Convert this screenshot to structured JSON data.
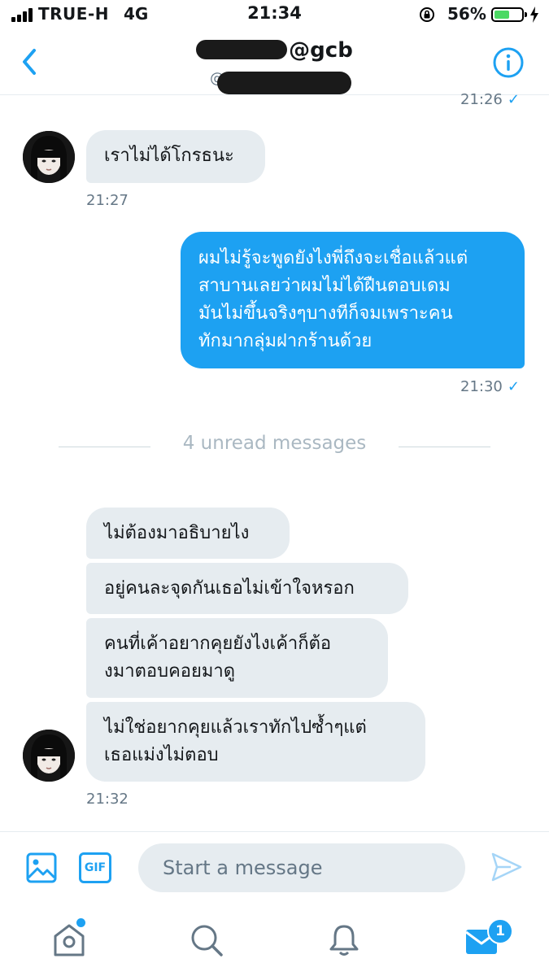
{
  "status_bar": {
    "carrier": "TRUE-H",
    "network": "4G",
    "time": "21:34",
    "battery_percent": "56%",
    "battery_level": 0.56,
    "icons": [
      "signal-icon",
      "orientation-lock-icon",
      "battery-icon",
      "charging-bolt-icon"
    ]
  },
  "header": {
    "title_handle": "@gcb",
    "back_icon": "chevron-left-icon",
    "info_icon": "info-icon",
    "accent_color": "#1da1f2"
  },
  "messages": {
    "top_timestamp": "21:26",
    "received_1": {
      "text": "เราไม่ได้โกรธนะ",
      "time": "21:27"
    },
    "sent_1": {
      "text": "ผมไม่รู้จะพูดยังไงพี่ถึงจะเชื่อแล้วแต่\nสาบานเลยว่าผมไม่ได้ฝืนตอบเดม\nมันไม่ขึ้นจริงๆบางทีก็จมเพราะคน\nทักมากลุ่มฝากร้านด้วย",
      "time": "21:30"
    },
    "unread_divider": "4 unread messages",
    "received_group": [
      "ไม่ต้องมาอธิบายไง",
      "อยู่คนละจุดกันเธอไม่เข้าใจหรอก",
      "คนที่เค้าอยากคุยยังไงเค้าก็ต้อ\nงมาตอบคอยมาดู",
      "ไม่ใช่อยากคุยแล้วเราทักไปซ้ำๆแต่\nเธอแม่งไม่ตอบ"
    ],
    "received_group_time": "21:32",
    "read_check": "✓",
    "bubble_in_color": "#e6ecf0",
    "bubble_out_color": "#1da1f2"
  },
  "composer": {
    "placeholder": "Start a message",
    "gif_label": "GIF",
    "image_icon": "image-icon",
    "send_icon": "send-icon"
  },
  "tab_bar": {
    "items": [
      "home-icon",
      "search-icon",
      "notifications-icon",
      "messages-icon"
    ],
    "messages_badge": "1"
  }
}
